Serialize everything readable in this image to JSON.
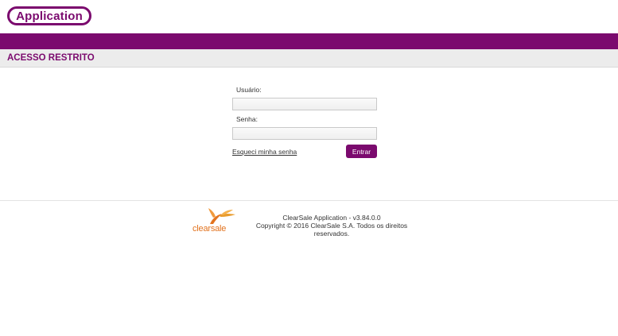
{
  "header": {
    "logo_text": "Application"
  },
  "section": {
    "title": "ACESSO RESTRITO"
  },
  "form": {
    "username_label": "Usuário:",
    "username_value": "",
    "password_label": "Senha:",
    "password_value": "",
    "forgot_link": "Esqueci minha senha",
    "submit_label": "Entrar"
  },
  "footer": {
    "brand_name": "clearsale",
    "version_line": "ClearSale Application - v3.84.0.0",
    "copyright_line": "Copyright © 2016 ClearSale S.A. Todos os direitos reservados."
  },
  "colors": {
    "brand_purple": "#7b0a6e",
    "brand_orange": "#e2731f"
  }
}
